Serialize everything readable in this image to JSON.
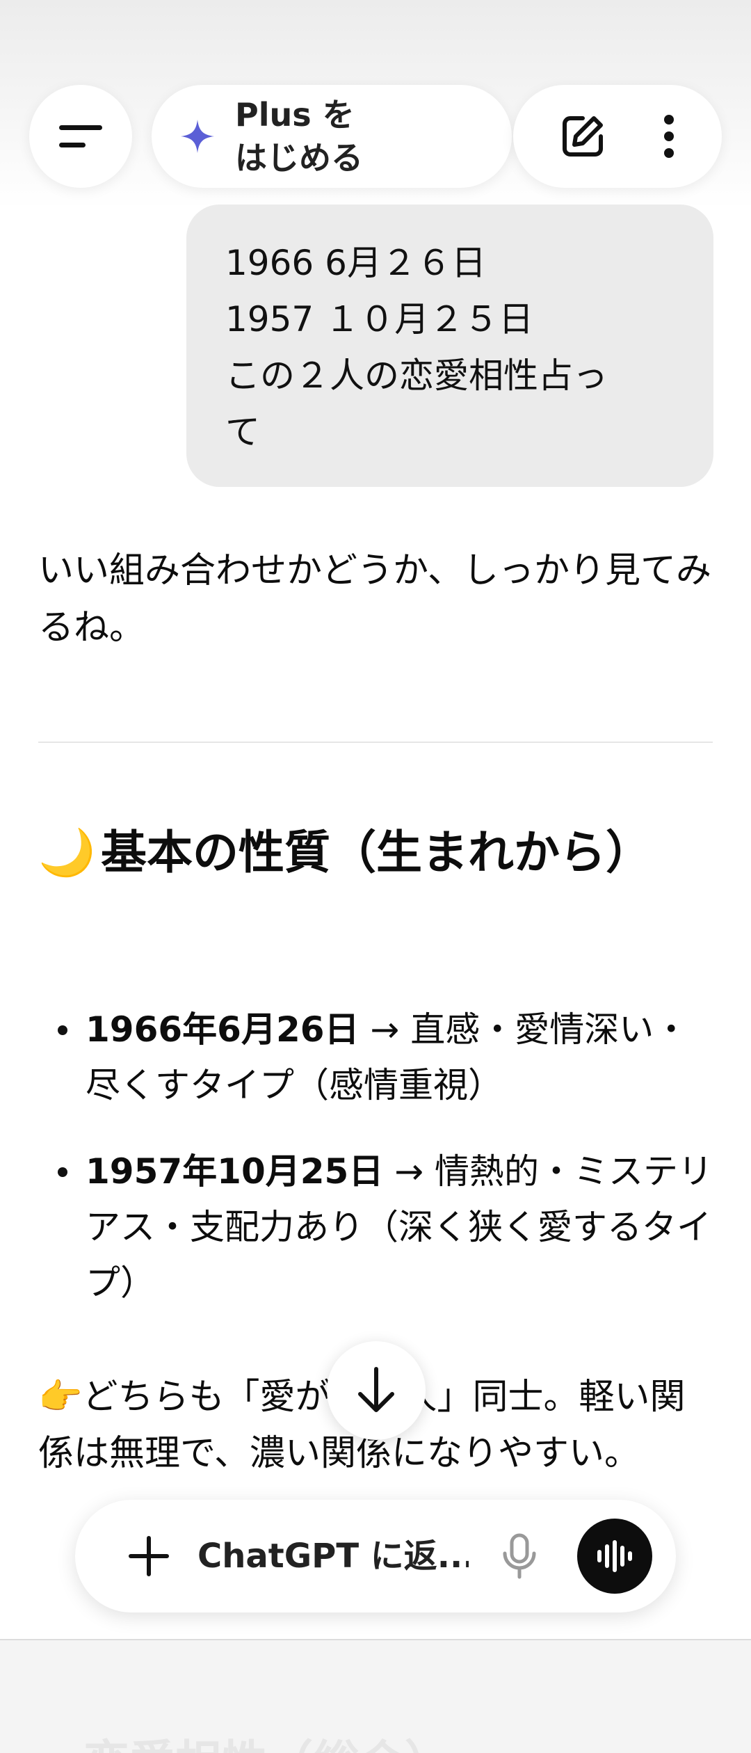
{
  "header": {
    "plus_label_line1": "Plus を",
    "plus_label_line2": "はじめる",
    "icons": [
      "menu-icon",
      "sparkle-icon",
      "edit-icon",
      "more-vertical-icon"
    ]
  },
  "user_message": {
    "lines": [
      "1966 6月２６日",
      "1957 １０月２５日",
      "この２人の恋愛相性占っ",
      "て"
    ]
  },
  "assistant": {
    "intro": "いい組み合わせかどうか、しっかり見てみるね。",
    "section_emoji": "🌙",
    "section_title": "基本の性質（生まれから）",
    "bullets": [
      {
        "date": "1966年6月26日",
        "text": " → 直感・愛情深い・尽くすタイプ（感情重視）"
      },
      {
        "date": "1957年10月25日",
        "text": " → 情熱的・ミステリアス・支配力あり（深く狭く愛するタイプ）"
      }
    ],
    "tail_emoji": "👉",
    "tail_text": "どちらも「愛が深い人」同士。軽い関係は無理で、濃い関係になりやすい。",
    "next_heading": "恋愛相性（総合）"
  },
  "composer": {
    "placeholder": "ChatGPT に返...",
    "icons": [
      "plus-icon",
      "mic-icon",
      "voice-wave-icon"
    ]
  },
  "colors": {
    "accent_sparkle": "#5b5fd6",
    "voice_button": "#0d0d0d",
    "bubble": "#ebebeb"
  }
}
